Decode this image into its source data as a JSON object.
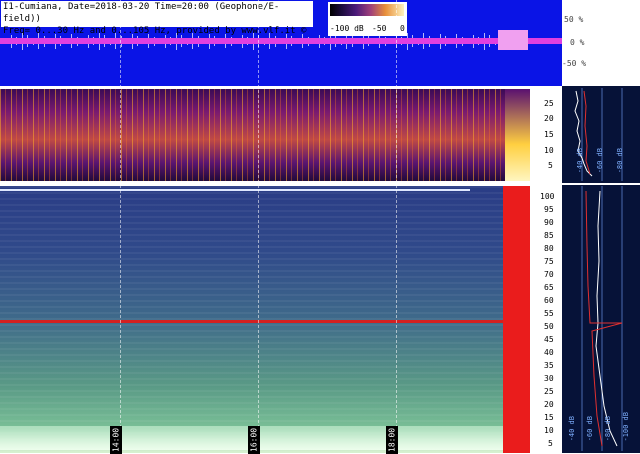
{
  "header": {
    "line1": "I1-Cumiana, Date=2018-03-20 Time=20:00 (Geophone/E-field))",
    "line2": "Freq= 0...30 Hz and 0...105 Hz, provided by www.vlf.it ©"
  },
  "colorbar": {
    "labels": [
      "-100 dB",
      "-50",
      "0"
    ]
  },
  "wave_axis": {
    "ticks": [
      "50 %",
      "0 %",
      "-50 %"
    ]
  },
  "spec1_axis": {
    "ticks": [
      "25",
      "20",
      "15",
      "10",
      "5"
    ]
  },
  "spec2_axis": {
    "ticks": [
      "100",
      "95",
      "90",
      "85",
      "80",
      "75",
      "70",
      "65",
      "60",
      "55",
      "50",
      "45",
      "40",
      "35",
      "30",
      "25",
      "20",
      "15",
      "10",
      "5"
    ]
  },
  "time_markers": [
    "14:00",
    "16:00",
    "18:00"
  ],
  "right_labels": {
    "top": [
      "-40 dB",
      "-60 dB",
      "-80 dB"
    ],
    "bottom": [
      "-40 dB",
      "-60 dB",
      "-80 dB",
      "-100 dB"
    ]
  },
  "colors": {
    "wave_bg": "#0a14e6",
    "accent_red": "#ea1c1c",
    "magenta": "#e040e0"
  }
}
